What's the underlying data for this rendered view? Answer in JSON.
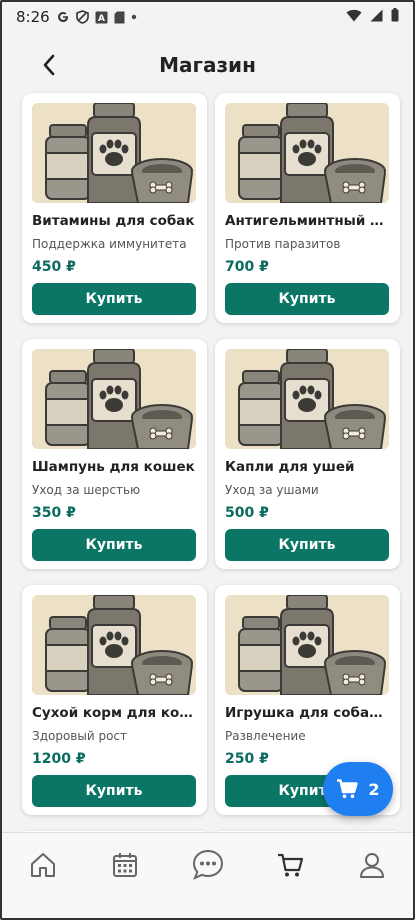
{
  "status_bar": {
    "time": "8:26",
    "icons": [
      "google-icon",
      "shield-icon",
      "a-icon",
      "sd-card-icon",
      "dot-icon"
    ],
    "right_icons": [
      "wifi-icon",
      "signal-icon",
      "battery-icon"
    ]
  },
  "header": {
    "title": "Магазин",
    "back_icon": "arrow-left-icon"
  },
  "products": [
    {
      "name": "Витамины для собак",
      "description": "Поддержка иммунитета",
      "price": "450 ₽",
      "button": "Купить"
    },
    {
      "name": "Антигельминтный пре...",
      "description": "Против паразитов",
      "price": "700 ₽",
      "button": "Купить"
    },
    {
      "name": "Шампунь для кошек",
      "description": "Уход за шерстью",
      "price": "350 ₽",
      "button": "Купить"
    },
    {
      "name": "Капли для ушей",
      "description": "Уход за ушами",
      "price": "500 ₽",
      "button": "Купить"
    },
    {
      "name": "Сухой корм для котят",
      "description": "Здоровый рост",
      "price": "1200 ₽",
      "button": "Купить"
    },
    {
      "name": "Игрушка для собак 'Ко...",
      "description": "Развлечение",
      "price": "250 ₽",
      "button": "Купить"
    }
  ],
  "cart_fab": {
    "count": "2",
    "icon": "cart-icon"
  },
  "bottom_nav": {
    "items": [
      "home-icon",
      "calendar-icon",
      "chat-icon",
      "cart-icon",
      "profile-icon"
    ]
  },
  "colors": {
    "accent": "#0b7666",
    "price": "#0a6b5e",
    "fab": "#1f7ff0",
    "image_bg": "#ece0c6"
  }
}
